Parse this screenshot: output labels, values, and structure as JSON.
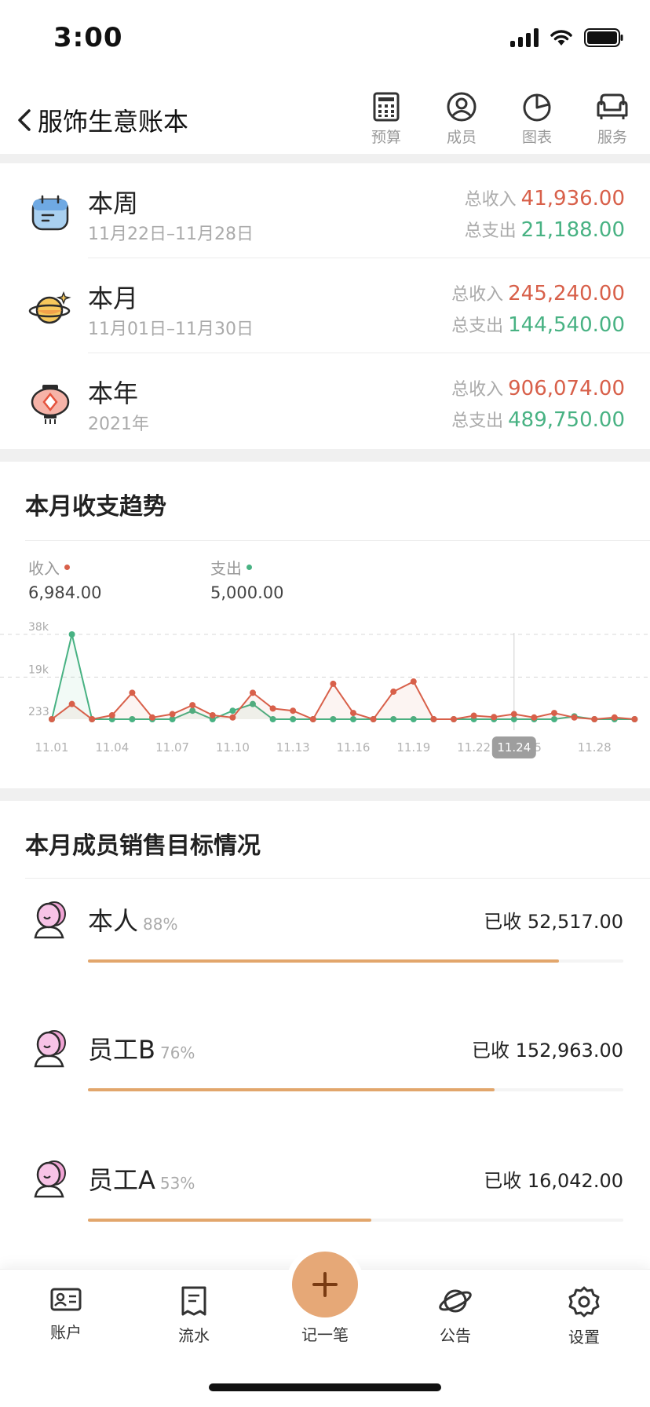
{
  "status_bar": {
    "time": "3:00"
  },
  "nav": {
    "title": "服饰生意账本",
    "actions": [
      {
        "label": "预算",
        "icon": "calculator-icon"
      },
      {
        "label": "成员",
        "icon": "user-circle-icon"
      },
      {
        "label": "图表",
        "icon": "pie-chart-icon"
      },
      {
        "label": "服务",
        "icon": "sofa-icon"
      }
    ]
  },
  "summary": [
    {
      "name": "本周",
      "range": "11月22日–11月28日",
      "income_label": "总收入",
      "income": "41,936.00",
      "expense_label": "总支出",
      "expense": "21,188.00"
    },
    {
      "name": "本月",
      "range": "11月01日–11月30日",
      "income_label": "总收入",
      "income": "245,240.00",
      "expense_label": "总支出",
      "expense": "144,540.00"
    },
    {
      "name": "本年",
      "range": "2021年",
      "income_label": "总收入",
      "income": "906,074.00",
      "expense_label": "总支出",
      "expense": "489,750.00"
    }
  ],
  "trend": {
    "title": "本月收支趋势",
    "income_label": "收入",
    "income_value": "6,984.00",
    "expense_label": "支出",
    "expense_value": "5,000.00",
    "income_color": "#d8604a",
    "expense_color": "#48b283",
    "selected_label": "11.24"
  },
  "chart_data": {
    "type": "line",
    "x": [
      "11.01",
      "11.02",
      "11.03",
      "11.04",
      "11.05",
      "11.06",
      "11.07",
      "11.08",
      "11.09",
      "11.10",
      "11.11",
      "11.12",
      "11.13",
      "11.14",
      "11.15",
      "11.16",
      "11.17",
      "11.18",
      "11.19",
      "11.20",
      "11.21",
      "11.22",
      "11.23",
      "11.24",
      "11.25",
      "11.26",
      "11.27",
      "11.28",
      "11.29",
      "11.30"
    ],
    "x_tick_labels": [
      "11.01",
      "11.04",
      "11.07",
      "11.10",
      "11.13",
      "11.16",
      "11.19",
      "11.22",
      "11.24",
      "25",
      "11.28"
    ],
    "y_tick_labels": [
      "38k",
      "19k",
      "233"
    ],
    "ylim": [
      233,
      38000
    ],
    "series": [
      {
        "name": "收入",
        "color": "#d8604a",
        "values": [
          233,
          7000,
          233,
          2000,
          12000,
          1000,
          2500,
          6500,
          2000,
          1000,
          12000,
          5000,
          4000,
          233,
          16000,
          3000,
          233,
          12500,
          17000,
          233,
          233,
          1800,
          1200,
          2500,
          1000,
          3000,
          1000,
          233,
          1000,
          233
        ]
      },
      {
        "name": "支出",
        "color": "#48b283",
        "values": [
          233,
          38000,
          233,
          233,
          233,
          233,
          233,
          4000,
          233,
          4000,
          7000,
          233,
          233,
          233,
          233,
          233,
          233,
          233,
          233,
          233,
          233,
          233,
          233,
          233,
          233,
          233,
          1500,
          233,
          233,
          233
        ]
      }
    ],
    "grid": true
  },
  "members": {
    "title": "本月成员销售目标情况",
    "received_prefix": "已收",
    "items": [
      {
        "name": "本人",
        "percent_text": "88%",
        "percent": 0.88,
        "amount": "已收 52,517.00"
      },
      {
        "name": "员工B",
        "percent_text": "76%",
        "percent": 0.76,
        "amount": "已收 152,963.00"
      },
      {
        "name": "员工A",
        "percent_text": "53%",
        "percent": 0.53,
        "amount": "已收 16,042.00"
      }
    ]
  },
  "tabbar": {
    "tabs": [
      {
        "label": "账户",
        "icon": "id-card-icon"
      },
      {
        "label": "流水",
        "icon": "receipt-icon"
      },
      {
        "label": "公告",
        "icon": "planet-icon"
      },
      {
        "label": "设置",
        "icon": "gear-icon"
      }
    ],
    "add_label": "记一笔"
  }
}
